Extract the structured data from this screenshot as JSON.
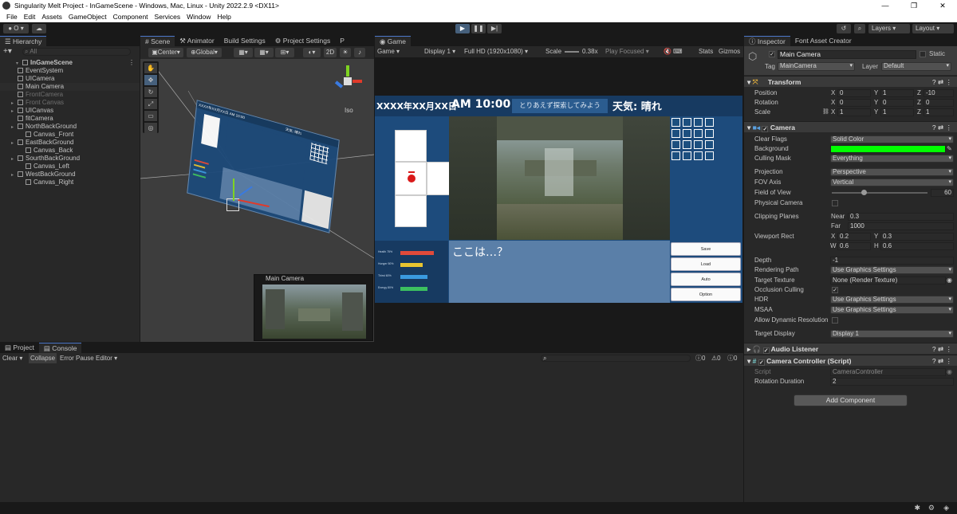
{
  "window": {
    "title": "Singularity Melt Project - InGameScene - Windows, Mac, Linux - Unity 2022.2.9 <DX11>"
  },
  "menu": [
    "File",
    "Edit",
    "Assets",
    "GameObject",
    "Component",
    "Services",
    "Window",
    "Help"
  ],
  "toolbar": {
    "account_label": "O",
    "layers_label": "Layers",
    "layout_label": "Layout"
  },
  "hierarchy": {
    "tab": "Hierarchy",
    "search_placeholder": "All",
    "items": [
      {
        "label": "InGameScene",
        "indent": 0,
        "dim": false,
        "bold": true
      },
      {
        "label": "EventSystem",
        "indent": 1,
        "dim": false
      },
      {
        "label": "UICamera",
        "indent": 1,
        "dim": false
      },
      {
        "label": "Main Camera",
        "indent": 1,
        "dim": false,
        "selected": true
      },
      {
        "label": "FrontCamera",
        "indent": 1,
        "dim": true
      },
      {
        "label": "Front Canvas",
        "indent": 1,
        "dim": true,
        "arrow": true
      },
      {
        "label": "UICanvas",
        "indent": 1,
        "dim": false,
        "arrow": true
      },
      {
        "label": "fitCamera",
        "indent": 1,
        "dim": false
      },
      {
        "label": "NorthBackGround",
        "indent": 1,
        "dim": false,
        "arrow": true
      },
      {
        "label": "Canvas_Front",
        "indent": 2,
        "dim": false
      },
      {
        "label": "EastBackGround",
        "indent": 1,
        "dim": false,
        "arrow": true
      },
      {
        "label": "Canvas_Back",
        "indent": 2,
        "dim": false
      },
      {
        "label": "SourthBackGround",
        "indent": 1,
        "dim": false,
        "arrow": true
      },
      {
        "label": "Canvas_Left",
        "indent": 2,
        "dim": false
      },
      {
        "label": "WestBackGround",
        "indent": 1,
        "dim": false,
        "arrow": true
      },
      {
        "label": "Canvas_Right",
        "indent": 2,
        "dim": false
      }
    ]
  },
  "scene": {
    "tabs": [
      "Scene",
      "Animator",
      "Build Settings",
      "Project Settings",
      "P"
    ],
    "pivot_label": "Center",
    "space_label": "Global",
    "mode_2d": "2D",
    "iso_label": "Iso",
    "camera_preview_title": "Main Camera",
    "mini_header": "XXXX年XX月XX日 AM 10:00",
    "mini_weather": "天気: 晴れ"
  },
  "game": {
    "tab": "Game",
    "mode": "Game",
    "display": "Display 1",
    "resolution": "Full HD (1920x1080)",
    "scale_label": "Scale",
    "scale_value": "0.38x",
    "play_focused": "Play Focused",
    "stats": "Stats",
    "gizmos": "Gizmos",
    "date": "XXXX年XX月XX日",
    "time": "AM 10:00",
    "hint": "とりあえず探索してみよう",
    "weather": "天気: 晴れ",
    "dialogue": "ここは…？",
    "buttons": [
      "Save",
      "Load",
      "Auto",
      "Option"
    ],
    "stats_bars": [
      {
        "label": "Health 75%",
        "fraction": 0.75,
        "color": "#e04a3a"
      },
      {
        "label": "Hunger 50%",
        "fraction": 0.5,
        "color": "#e8c430"
      },
      {
        "label": "Thirst 60%",
        "fraction": 0.6,
        "color": "#3a9ae0"
      },
      {
        "label": "Energy 80%",
        "fraction": 0.6,
        "color": "#3cc060"
      }
    ]
  },
  "inspector": {
    "tabs": [
      "Inspector",
      "Font Asset Creator"
    ],
    "object_name": "Main Camera",
    "static_label": "Static",
    "tag_label": "Tag",
    "tag_value": "MainCamera",
    "layer_label": "Layer",
    "layer_value": "Default",
    "transform": {
      "title": "Transform",
      "position": {
        "label": "Position",
        "x": "0",
        "y": "1",
        "z": "-10"
      },
      "rotation": {
        "label": "Rotation",
        "x": "0",
        "y": "0",
        "z": "0"
      },
      "scale": {
        "label": "Scale",
        "x": "1",
        "y": "1",
        "z": "1"
      }
    },
    "camera": {
      "title": "Camera",
      "clear_flags": {
        "label": "Clear Flags",
        "value": "Solid Color"
      },
      "background": {
        "label": "Background",
        "color": "#00ff00"
      },
      "culling_mask": {
        "label": "Culling Mask",
        "value": "Everything"
      },
      "projection": {
        "label": "Projection",
        "value": "Perspective"
      },
      "fov_axis": {
        "label": "FOV Axis",
        "value": "Vertical"
      },
      "fov": {
        "label": "Field of View",
        "value": "60"
      },
      "physical": {
        "label": "Physical Camera"
      },
      "clipping": {
        "label": "Clipping Planes",
        "near_label": "Near",
        "near": "0.3",
        "far_label": "Far",
        "far": "1000"
      },
      "viewport": {
        "label": "Viewport Rect",
        "x": "0.2",
        "y": "0.3",
        "w": "0.6",
        "h": "0.6"
      },
      "depth": {
        "label": "Depth",
        "value": "-1"
      },
      "rendering_path": {
        "label": "Rendering Path",
        "value": "Use Graphics Settings"
      },
      "target_texture": {
        "label": "Target Texture",
        "value": "None (Render Texture)"
      },
      "occlusion": {
        "label": "Occlusion Culling"
      },
      "hdr": {
        "label": "HDR",
        "value": "Use Graphics Settings"
      },
      "msaa": {
        "label": "MSAA",
        "value": "Use Graphics Settings"
      },
      "dynamic_res": {
        "label": "Allow Dynamic Resolution"
      },
      "target_display": {
        "label": "Target Display",
        "value": "Display 1"
      }
    },
    "audio_listener": {
      "title": "Audio Listener"
    },
    "camera_controller": {
      "title": "Camera Controller (Script)",
      "script_label": "Script",
      "script_value": "CameraController",
      "rotation_label": "Rotation Duration",
      "rotation_value": "2"
    },
    "add_component": "Add Component"
  },
  "console": {
    "tabs": [
      "Project",
      "Console"
    ],
    "clear": "Clear",
    "collapse": "Collapse",
    "error_pause": "Error Pause",
    "editor": "Editor",
    "counts": [
      "0",
      "0",
      "0"
    ]
  }
}
